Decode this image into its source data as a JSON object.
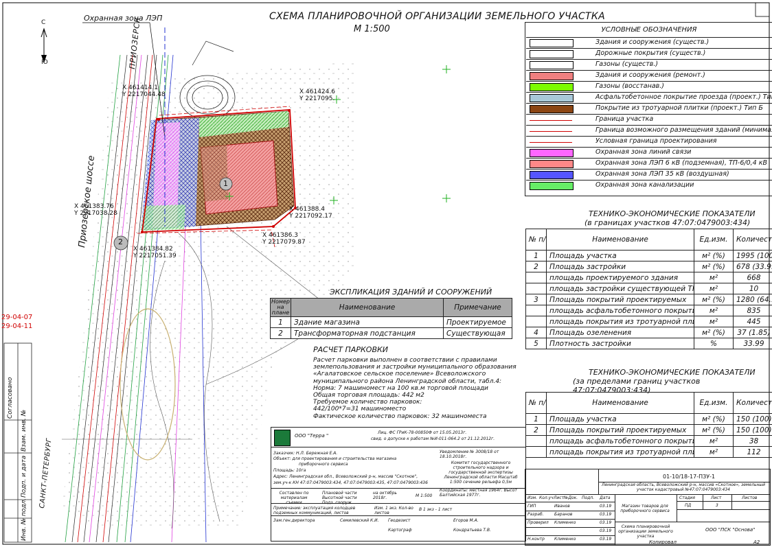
{
  "drawing": {
    "title": "СХЕМА ПЛАНИРОВОЧНОЙ ОРГАНИЗАЦИИ ЗЕМЕЛЬНОГО УЧАСТКА",
    "scale": "М 1:500",
    "lep_zone_label": "Охранная зона ЛЭП",
    "north": "С",
    "south": "Ю",
    "road_label_1": "ПРИОЗЕРСК",
    "road_label_2": "Приозерское шоссе",
    "road_label_3": "САНКТ-ПЕТЕРБУРГ",
    "building_1": "1",
    "building_2": "2",
    "coords": [
      {
        "x": "X 461424.6",
        "y": "Y 2217095."
      },
      {
        "x": "X 461388.4",
        "y": "Y 2217092.17"
      },
      {
        "x": "X 461386.3",
        "y": "Y 2217079.87"
      },
      {
        "x": "X 461384.82",
        "y": "Y 2217051.39"
      },
      {
        "x": "X 461383.76",
        "y": "Y 2217038.28"
      },
      {
        "x": "X 461414.1",
        "y": "Y 2217044.48"
      }
    ],
    "side_marks": [
      "29-04-07",
      "29-04-11"
    ]
  },
  "legend": {
    "title": "УСЛОВНЫЕ ОБОЗНАЧЕНИЯ",
    "items": [
      {
        "label": "Здания и сооружения (существ.)",
        "color": "#ffffff"
      },
      {
        "label": "Дорожные покрытия (существ.)",
        "color": "#ffffff"
      },
      {
        "label": "Газоны (существ.)",
        "color": "#ffffff"
      },
      {
        "label": "Здания и сооружения (ремонт.)",
        "color": "#f08080"
      },
      {
        "label": "Газоны (восстанав.)",
        "color": "#7cfc00"
      },
      {
        "label": "Асфальтобетонное покрытие проезда (проект.) Тип А",
        "color": "#a8c8d8"
      },
      {
        "label": "Покрытие из тротуарной плитки (проект.) Тип Б",
        "color": "#8b4513"
      },
      {
        "label": "Граница участка",
        "color": "#d00000"
      },
      {
        "label": "Граница возможного размещения зданий (минимальные отс",
        "color": "#d00000"
      },
      {
        "label": "Условная граница проектирования",
        "color": "#d00000"
      },
      {
        "label": "Охранная зона линий связи",
        "color": "#ff66ff"
      },
      {
        "label": "Охранная зона ЛЭП 6 кВ (подземная), ТП-6/0,4 кВ",
        "color": "#ff8888"
      },
      {
        "label": "Охранная зона ЛЭП 35 кВ (воздушная)",
        "color": "#5555ff"
      },
      {
        "label": "Охранная зона канализации",
        "color": "#66ee66"
      }
    ]
  },
  "tep1": {
    "title": "ТЕХНИКО-ЭКОНОМИЧЕСКИЕ ПОКАЗАТЕЛИ",
    "subtitle": "(в границах участков 47:07:0479003:434)",
    "headers": [
      "№ п/п",
      "Наименование",
      "Ед.изм.",
      "Количество"
    ],
    "rows": [
      [
        "1",
        "Площадь участка",
        "м² (%)",
        "1995 (100)"
      ],
      [
        "2",
        "Площадь застройки",
        "м² (%)",
        "678 (33.99)"
      ],
      [
        "",
        "площадь проектируемого здания",
        "м²",
        "668"
      ],
      [
        "",
        "площадь застройки существующей ТП",
        "м²",
        "10"
      ],
      [
        "3",
        "Площадь покрытий проектируемых",
        "м² (%)",
        "1280 (64.16)"
      ],
      [
        "",
        "площадь асфальтобетонного покрытия проездов",
        "м²",
        "835"
      ],
      [
        "",
        "площадь покрытия из тротуарной плитки",
        "м²",
        "445"
      ],
      [
        "4",
        "Площадь озеленения",
        "м² (%)",
        "37 (1.85)"
      ],
      [
        "5",
        "Плотность застройки",
        "%",
        "33.99"
      ]
    ]
  },
  "tep2": {
    "title": "ТЕХНИКО-ЭКОНОМИЧЕСКИЕ ПОКАЗАТЕЛИ",
    "subtitle": "(за пределами границ участков 47:07:0479003:434)",
    "headers": [
      "№ п/п",
      "Наименование",
      "Ед.изм.",
      "Количество"
    ],
    "rows": [
      [
        "1",
        "Площадь участка",
        "м² (%)",
        "150 (100)"
      ],
      [
        "2",
        "Площадь покрытий проектируемых",
        "м² (%)",
        "150 (100)"
      ],
      [
        "",
        "площадь асфальтобетонного покрытия проездов",
        "м²",
        "38"
      ],
      [
        "",
        "площадь покрытия из тротуарной плитки",
        "м²",
        "112"
      ]
    ]
  },
  "explication": {
    "title": "ЭКСПЛИКАЦИЯ ЗДАНИЙ И СООРУЖЕНИЙ",
    "headers": [
      "Номер на плане",
      "Наименование",
      "Примечание"
    ],
    "rows": [
      [
        "1",
        "Здание магазина",
        "Проектируемое"
      ],
      [
        "2",
        "Трансформаторная подстанция",
        "Существующая"
      ]
    ]
  },
  "parking": {
    "title": "РАСЧЕТ ПАРКОВКИ",
    "lines": [
      "Расчет парковки выполнен в соответствии с правилами",
      "землепользования и застройки муниципального образования",
      "«Агалатовское сельское поселение» Всеволожского",
      "муниципального района Ленинградской области, табл.4:",
      "Норма: 7 машиномест на 100 кв.м торговой площади",
      "Общая торговая площадь: 442 м2",
      "Требуемое количество парковок:",
      "442/100*7=31 машиноместо",
      "Фактическое количество парковок: 32 машиноместа"
    ]
  },
  "stamp": {
    "company": "ООО \"Терра \"",
    "license": "Лиц. ФС ГРиК-78-00850Ф от 15.05.2013г.",
    "license2": "свид. о допуске к работам №И-011-064.2 от 21.12.2012г.",
    "customer": "Заказчик: Н.Л. Бережная Е.А.",
    "object": "Объект: для проектирования и строительства магазина",
    "object2": "приборочного сервиса",
    "area": "Площадь: 10га",
    "address": "Адрес: Ленинградская обл., Всеволожский р-н, массив \"Скотное\",",
    "address2": "зем.уч-к КН 47:07:0479003:434, 47:07:0479003:435, 47:07:0479003:436",
    "composed": "Составлен по материалам съемки",
    "plan_part": "Плановой части Высотной части Подз. сооруж.",
    "date": "на октябрь 2018г.",
    "scale": "М 1:500",
    "notice": "Уведомление № 3008/18 от 18.10.2018г.",
    "committee": "Комитет государственного строительного надзора и государственной экспертизы Ленинградской области Масштаб 1:500 сечение рельефа 0,5м",
    "system": "Координаты: местная 1964г. Высот Балтийская 1977г.",
    "note": "Примечание: эксплуатация колодцев подземных коммуникаций, листов",
    "sign_rows": [
      [
        "Зам.ген.директора",
        "Семилевский К.И."
      ],
      [
        "Геодезист",
        "Егоров М.А."
      ],
      [
        "Картограф",
        "Кондратьева Т.В."
      ]
    ],
    "sheets": "Изм. 1 экз. Кол-во листов",
    "sheet_count": "В 1 экз - 1 лист"
  },
  "titleblock": {
    "code": "01-10/18-17-ПЗУ-1",
    "place": "Ленинградская область, Всеволожский р-н, массив «Скотное», земельный участок кадастровый №47:07:0479003:434",
    "headers": [
      "Изм.",
      "Кол.уч",
      "Лист",
      "№Док.",
      "Подп.",
      "Дата"
    ],
    "people": [
      {
        "role": "ГИП",
        "name": "Иванов",
        "date": "03.19"
      },
      {
        "role": "Разраб.",
        "name": "Баранов",
        "date": "03.19"
      },
      {
        "role": "Проверил",
        "name": "Клименко",
        "date": "03.19"
      },
      {
        "role": "",
        "name": "",
        "date": "03.19"
      },
      {
        "role": "Н.контр",
        "name": "Клименко",
        "date": "03.19"
      }
    ],
    "object": "Магазин товаров для приборочного сервиса",
    "stage_h": "Стадия",
    "sheet_h": "Лист",
    "sheets_h": "Листов",
    "stage": "ПД",
    "sheet": "3",
    "sheets": "",
    "sheet_title": "Схема планировочной организации земельного участка",
    "org": "ООО \"ПСК \"Основа\"",
    "copied": "Копировал",
    "format": "А2"
  },
  "side_stamp": {
    "agreed": "Согласовано",
    "inv_no": "Взам. инв. №",
    "sign_date": "Подп. и дата",
    "inv_orig": "Инв. № подл."
  }
}
